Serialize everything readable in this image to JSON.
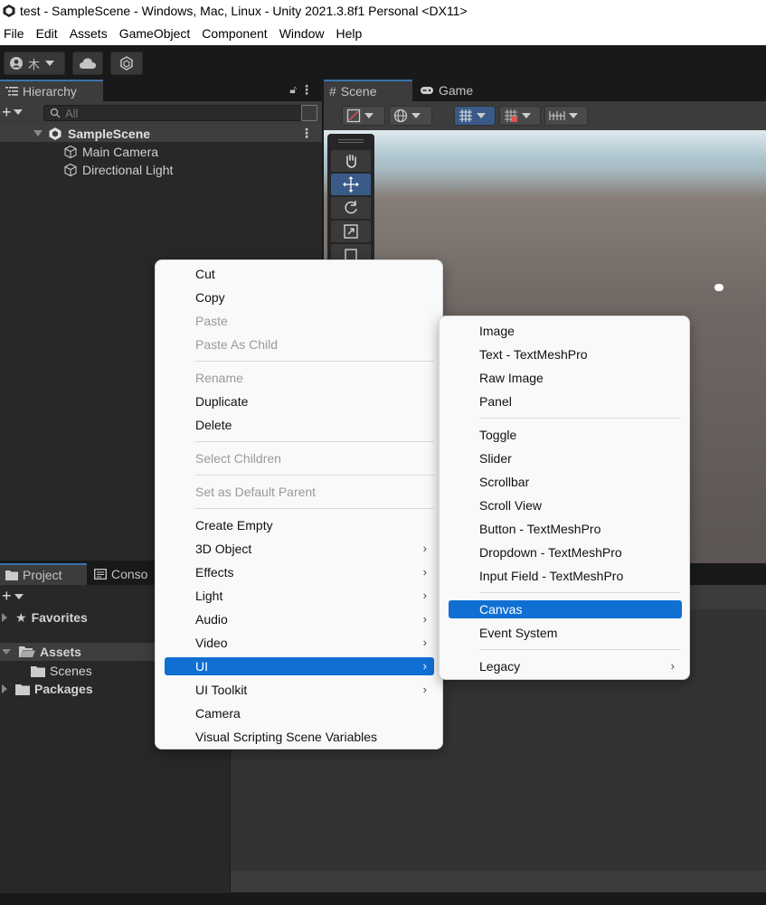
{
  "window": {
    "title": "test - SampleScene - Windows, Mac, Linux - Unity 2021.3.8f1 Personal <DX11>"
  },
  "menubar": [
    "File",
    "Edit",
    "Assets",
    "GameObject",
    "Component",
    "Window",
    "Help"
  ],
  "toolbar": {
    "account_name": "木"
  },
  "hierarchy": {
    "tab_label": "Hierarchy",
    "search_placeholder": "All",
    "scene_name": "SampleScene",
    "items": [
      "Main Camera",
      "Directional Light"
    ]
  },
  "scene_view": {
    "tabs": [
      "Scene",
      "Game"
    ]
  },
  "project": {
    "tabs": [
      "Project",
      "Conso"
    ],
    "favorites": "Favorites",
    "assets": "Assets",
    "scenes": "Scenes",
    "packages": "Packages"
  },
  "context_menu": {
    "items": [
      {
        "label": "Cut",
        "disabled": false
      },
      {
        "label": "Copy",
        "disabled": false
      },
      {
        "label": "Paste",
        "disabled": true
      },
      {
        "label": "Paste As Child",
        "disabled": true
      },
      {
        "label": "Rename",
        "disabled": true
      },
      {
        "label": "Duplicate",
        "disabled": false
      },
      {
        "label": "Delete",
        "disabled": false
      },
      {
        "label": "Select Children",
        "disabled": true
      },
      {
        "label": "Set as Default Parent",
        "disabled": true
      },
      {
        "label": "Create Empty",
        "disabled": false
      },
      {
        "label": "3D Object",
        "disabled": false,
        "submenu": true
      },
      {
        "label": "Effects",
        "disabled": false,
        "submenu": true
      },
      {
        "label": "Light",
        "disabled": false,
        "submenu": true
      },
      {
        "label": "Audio",
        "disabled": false,
        "submenu": true
      },
      {
        "label": "Video",
        "disabled": false,
        "submenu": true
      },
      {
        "label": "UI",
        "disabled": false,
        "submenu": true,
        "selected": true
      },
      {
        "label": "UI Toolkit",
        "disabled": false,
        "submenu": true
      },
      {
        "label": "Camera",
        "disabled": false
      },
      {
        "label": "Visual Scripting Scene Variables",
        "disabled": false
      }
    ]
  },
  "ui_submenu": {
    "items": [
      {
        "label": "Image"
      },
      {
        "label": "Text - TextMeshPro"
      },
      {
        "label": "Raw Image"
      },
      {
        "label": "Panel"
      },
      {
        "label": "Toggle"
      },
      {
        "label": "Slider"
      },
      {
        "label": "Scrollbar"
      },
      {
        "label": "Scroll View"
      },
      {
        "label": "Button - TextMeshPro"
      },
      {
        "label": "Dropdown - TextMeshPro"
      },
      {
        "label": "Input Field - TextMeshPro"
      },
      {
        "label": "Canvas",
        "selected": true
      },
      {
        "label": "Event System"
      },
      {
        "label": "Legacy",
        "submenu": true
      }
    ]
  },
  "colors": {
    "selection": "#0f6fd2",
    "active_tab_accent": "#3a72b0",
    "panel_bg": "#282828"
  }
}
